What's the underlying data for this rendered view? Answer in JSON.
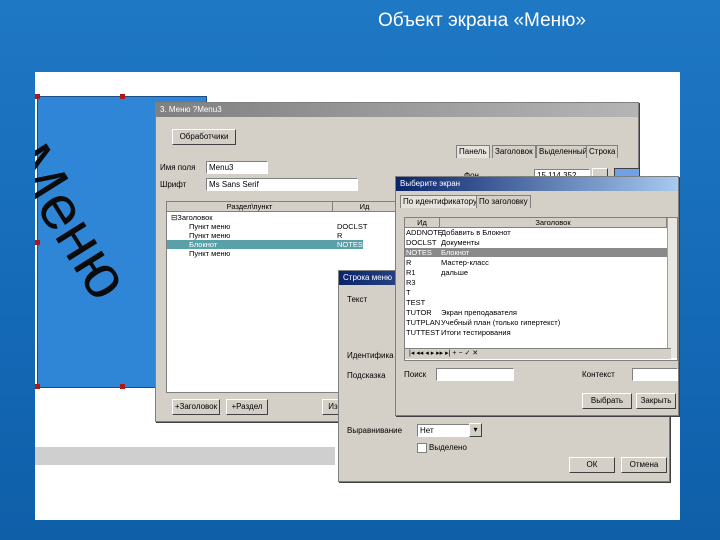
{
  "slide_title": "Объект экрана «Меню»",
  "canvas": {
    "menu_text": "Меню"
  },
  "menu_window": {
    "title": "3. Меню ?Menu3",
    "handlers_btn": "Обработчики",
    "name_label": "Имя поля",
    "name_value": "Menu3",
    "font_label": "Шрифт",
    "font_value": "Ms Sans Serif",
    "col_section": "Раздел\\пункт",
    "col_id": "Ид",
    "tree": [
      {
        "text": "Заголовок",
        "id": ""
      },
      {
        "text": "Пункт меню",
        "id": "DOCLST"
      },
      {
        "text": "Пункт меню",
        "id": "R"
      },
      {
        "text": "Блокнот",
        "id": "NOTES"
      },
      {
        "text": "Пункт меню",
        "id": ""
      }
    ],
    "tabs": [
      "Панель",
      "Заголовок",
      "Выделенный",
      "Строка"
    ],
    "bg_label": "Фон",
    "bg_value": "15,114,352",
    "add_header_btn": "+Заголовок",
    "add_section_btn": "+Раздел",
    "cut_btn": "Из"
  },
  "line_window": {
    "title": "Строка меню",
    "text_label": "Текст",
    "id_label": "Идентифика",
    "hint_label": "Подсказка",
    "align_label": "Выравнивание",
    "align_value": "Нет",
    "highlight_label": "Выделено",
    "ok_btn": "ОК",
    "cancel_btn": "Отмена"
  },
  "screen_window": {
    "title": "Выберите экран",
    "tabs": [
      "По идентификатору",
      "По заголовку"
    ],
    "col_id": "Ид",
    "col_title": "Заголовок",
    "rows": [
      {
        "id": "ADDNOTE",
        "title": "Добавить в Блокнот"
      },
      {
        "id": "DOCLST",
        "title": "Документы"
      },
      {
        "id": "NOTES",
        "title": "Блокнот"
      },
      {
        "id": "R",
        "title": "Мастер-класс"
      },
      {
        "id": "R1",
        "title": "дальше"
      },
      {
        "id": "R3",
        "title": ""
      },
      {
        "id": "T",
        "title": ""
      },
      {
        "id": "TEST",
        "title": ""
      },
      {
        "id": "TUTOR",
        "title": "Экран преподавателя"
      },
      {
        "id": "TUTPLAN",
        "title": "Учебный план (только гипертекст)"
      },
      {
        "id": "TUTTEST",
        "title": "Итоги тестирования"
      }
    ],
    "search_label": "Поиск",
    "context_label": "Контекст",
    "choose_btn": "Выбрать",
    "close_btn": "Закрыть"
  }
}
